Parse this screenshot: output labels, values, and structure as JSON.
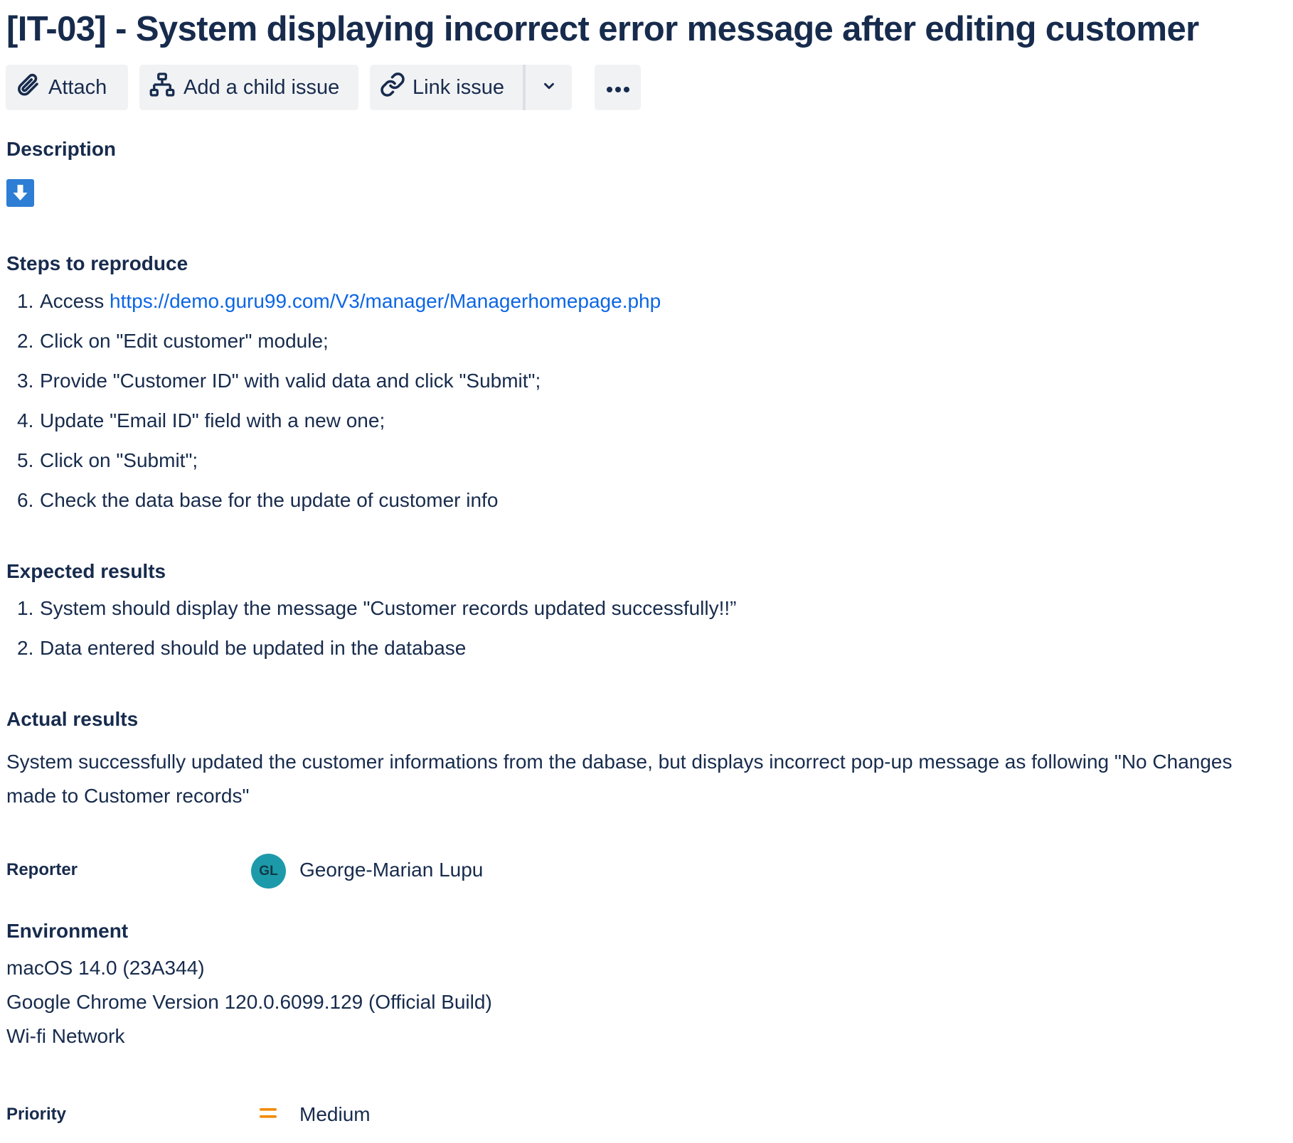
{
  "issue": {
    "title": "[IT-03] - System displaying incorrect error message after editing customer"
  },
  "toolbar": {
    "attach_label": "Attach",
    "child_label": "Add a child issue",
    "link_label": "Link issue"
  },
  "description": {
    "heading": "Description"
  },
  "steps": {
    "heading": "Steps to reproduce",
    "items": [
      {
        "num": "1.",
        "prefix": "Access ",
        "link": "https://demo.guru99.com/V3/manager/Managerhomepage.php"
      },
      {
        "num": "2.",
        "text": "Click on \"Edit customer\" module;"
      },
      {
        "num": "3.",
        "text": "Provide \"Customer ID\" with valid data and click \"Submit\";"
      },
      {
        "num": "4.",
        "text": "Update \"Email ID\" field with a new one;"
      },
      {
        "num": "5.",
        "text": "Click on \"Submit\";"
      },
      {
        "num": "6.",
        "text": "Check the data base for the update of customer info"
      }
    ]
  },
  "expected": {
    "heading": "Expected results",
    "items": [
      {
        "num": "1.",
        "text": "System should display the message \"Customer records updated successfully!!”"
      },
      {
        "num": "2.",
        "text": "Data entered should be updated in the database"
      }
    ]
  },
  "actual": {
    "heading": "Actual results",
    "text": "System successfully updated the customer informations from the dabase, but displays incorrect pop-up message as following \"No Changes made to Customer records\""
  },
  "reporter": {
    "label": "Reporter",
    "initials": "GL",
    "name": "George-Marian Lupu",
    "avatar_color": "#1d9aaa"
  },
  "environment": {
    "heading": "Environment",
    "lines": [
      "macOS 14.0 (23A344)",
      "Google Chrome Version 120.0.6099.129 (Official Build)",
      "Wi-fi Network"
    ]
  },
  "priority": {
    "label": "Priority",
    "value": "Medium",
    "color": "#f38a00"
  },
  "icons": [
    "paperclip-icon",
    "child-issue-icon",
    "link-icon",
    "chevron-down-icon",
    "more-icon",
    "download-icon",
    "priority-medium-icon"
  ],
  "colors": {
    "text": "#172b4d",
    "link": "#0c66e4",
    "button_bg": "#f1f2f4",
    "download_icon_bg": "#2d7ed4"
  }
}
